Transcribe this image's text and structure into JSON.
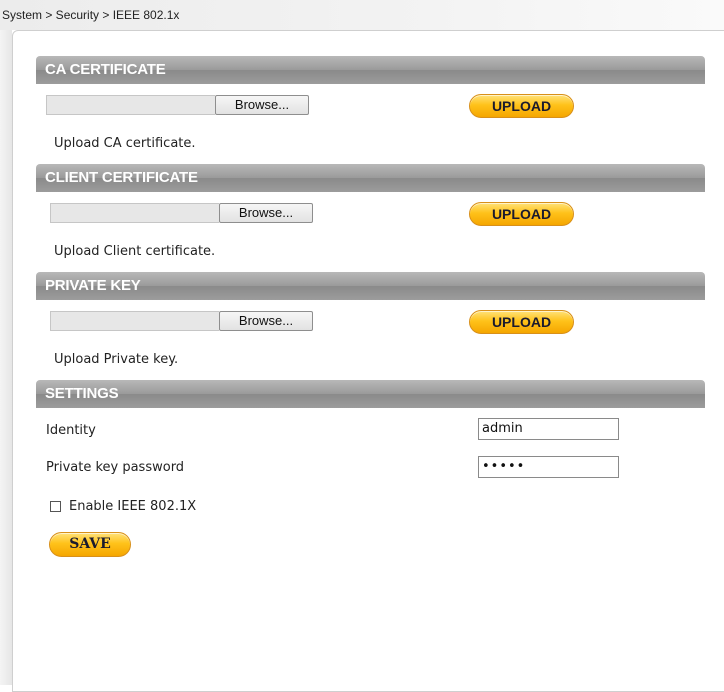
{
  "breadcrumb": "System > Security > IEEE 802.1x",
  "sections": {
    "ca": {
      "title": "CA CERTIFICATE",
      "browse_label": "Browse...",
      "upload_label": "UPLOAD",
      "description": "Upload CA certificate."
    },
    "client": {
      "title": "CLIENT CERTIFICATE",
      "browse_label": "Browse...",
      "upload_label": "UPLOAD",
      "description": "Upload Client certificate."
    },
    "private_key": {
      "title": "PRIVATE KEY",
      "browse_label": "Browse...",
      "upload_label": "UPLOAD",
      "description": "Upload Private key."
    },
    "settings": {
      "title": "SETTINGS"
    }
  },
  "settings": {
    "identity_label": "Identity",
    "identity_value": "admin",
    "password_label": "Private key password",
    "password_value": "•••••",
    "enable_label": "Enable IEEE 802.1X",
    "enable_checked": false,
    "save_label": "SAVE"
  },
  "colors": {
    "section_header": "#9c9c9c",
    "button_accent": "#ffc21a"
  }
}
